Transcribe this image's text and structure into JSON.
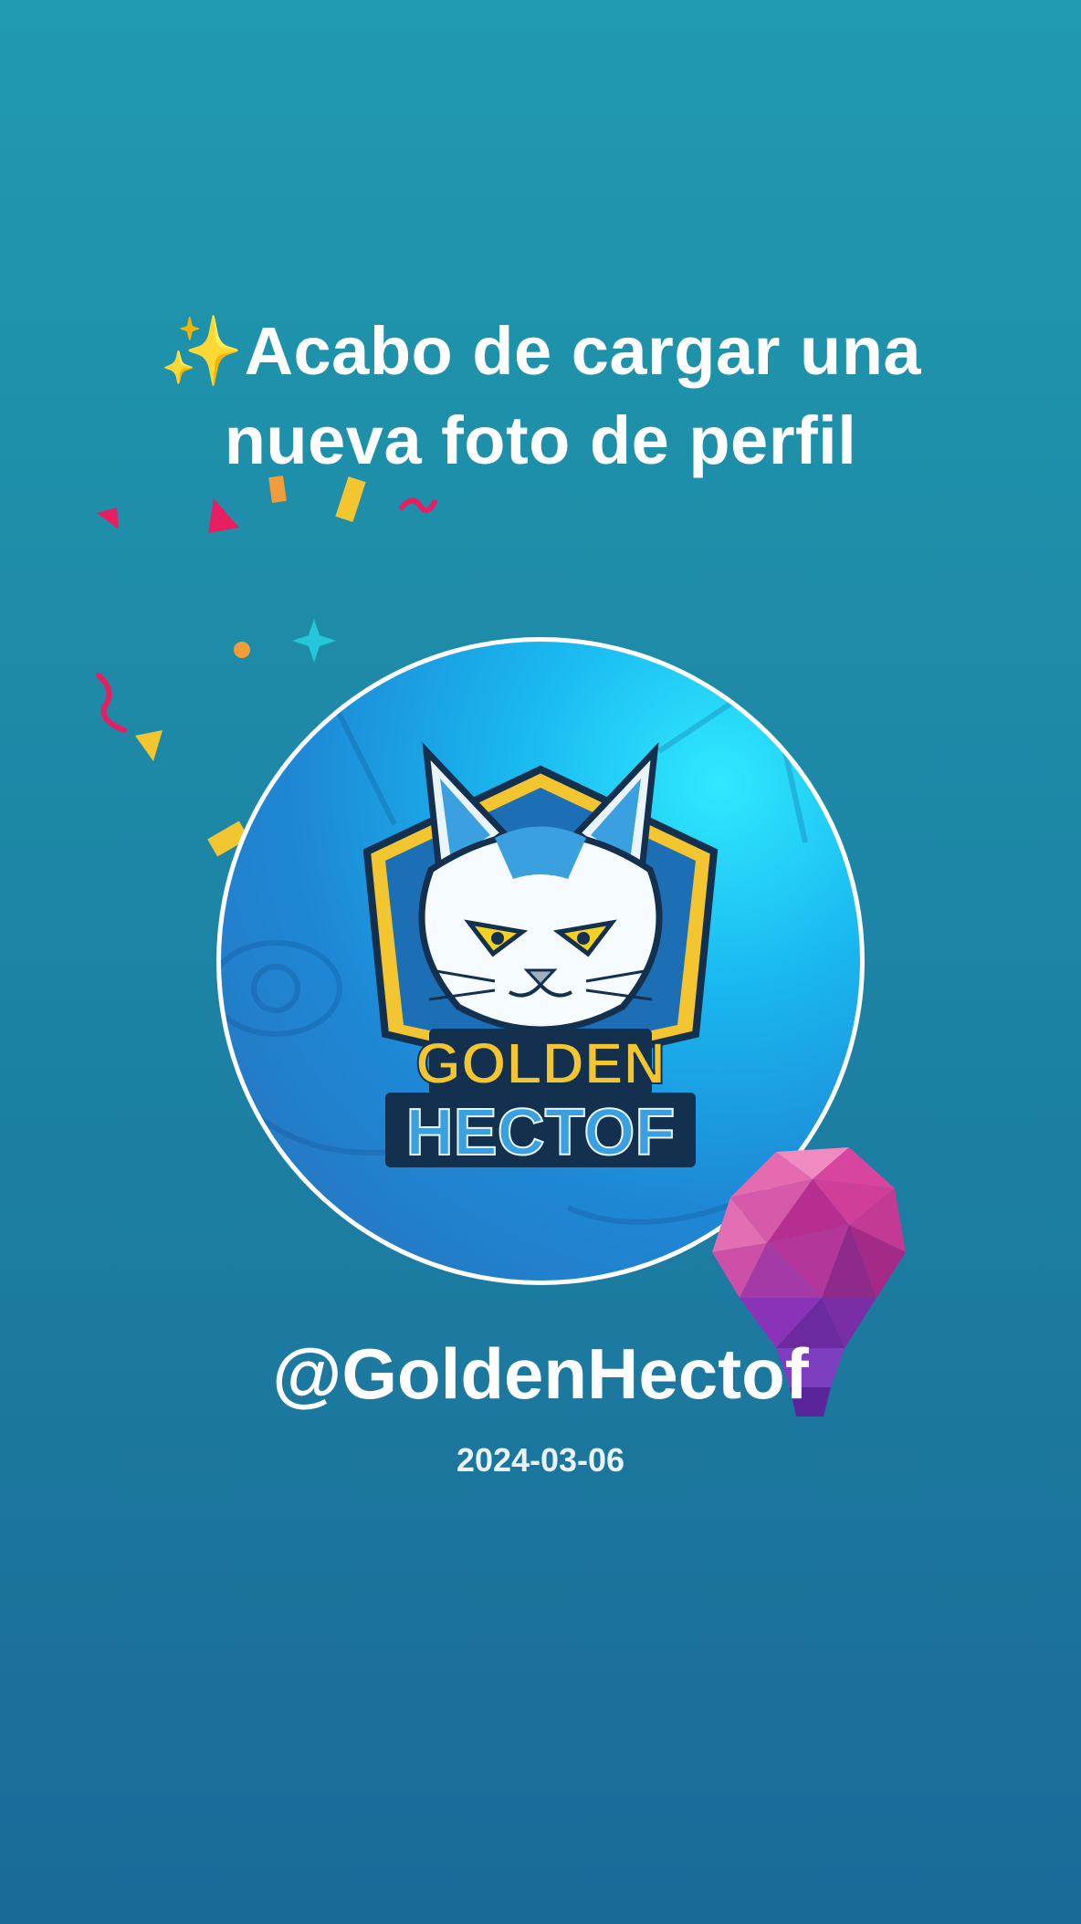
{
  "post": {
    "sparkle_icon": "sparkles-icon",
    "headline_line1": "Acabo de cargar una",
    "headline_line2": "nueva foto de perfil",
    "username": "@GoldenHectof",
    "date": "2024-03-06"
  },
  "avatar": {
    "logo_line1": "GOLDEN",
    "logo_line2": "HECTOF",
    "mascot": "white-cat-mascot-icon"
  },
  "decorations": {
    "bulb": "lightbulb-icon",
    "confetti": "confetti-icon"
  },
  "colors": {
    "background_top": "#209aae",
    "background_bottom": "#1a6a98",
    "text": "#ffffff",
    "avatar_ring": "#ffffff",
    "logo_gold": "#f2c531",
    "logo_blue": "#1f8fd6"
  }
}
